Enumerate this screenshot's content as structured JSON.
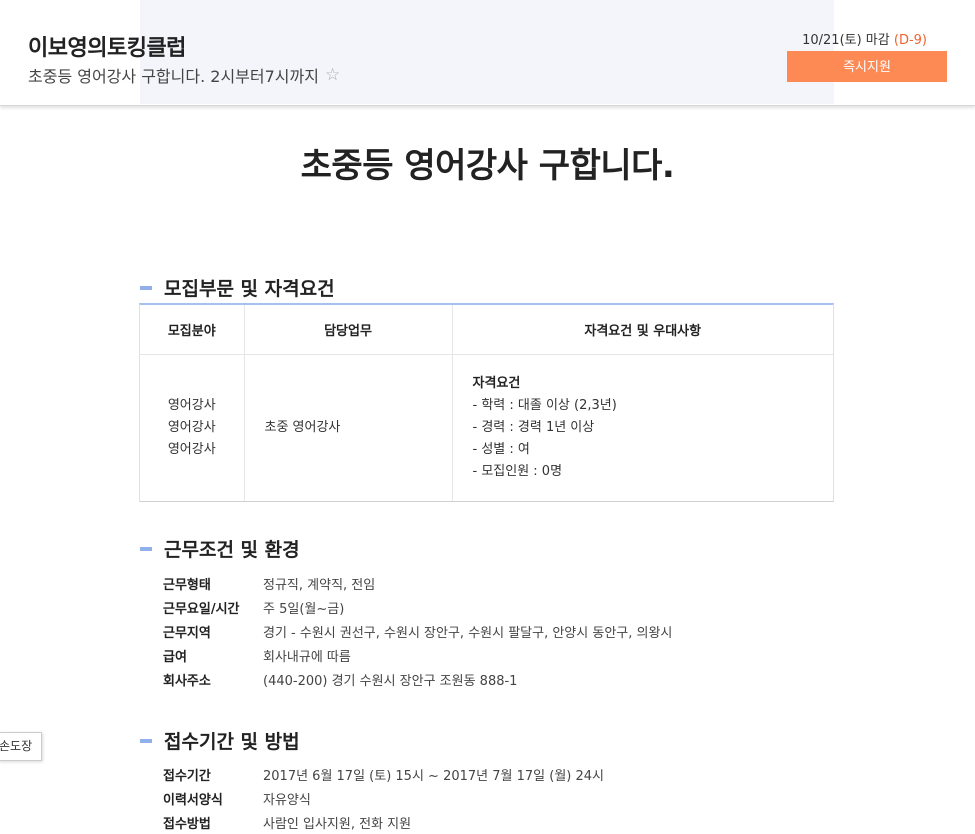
{
  "header": {
    "company": "이보영의토킹클럽",
    "subtitle": "초중등 영어강사 구합니다. 2시부터7시까지",
    "star_icon": "☆",
    "deadline_prefix": "10/21(토) 마감 ",
    "dday": "(D-9)",
    "apply_label": "즉시지원"
  },
  "main": {
    "title": "초중등 영어강사 구합니다."
  },
  "recruit": {
    "heading": "모집부문 및 자격요건",
    "columns": [
      "모집분야",
      "담당업무",
      "자격요건 및 우대사항"
    ],
    "fields": [
      "영어강사",
      "영어강사",
      "영어강사"
    ],
    "duty": "초중 영어강사",
    "qual_title": "자격요건",
    "qualifications": [
      "- 학력 : 대졸 이상 (2,3년)",
      "- 경력 : 경력 1년 이상",
      "- 성별 : 여",
      "- 모집인원 : 0명"
    ]
  },
  "conditions": {
    "heading": "근무조건 및 환경",
    "rows": [
      {
        "key": "근무형태",
        "value": "정규직, 계약직, 전임"
      },
      {
        "key": "근무요일/시간",
        "value": "주 5일(월~금)"
      },
      {
        "key": "근무지역",
        "value": "경기 - 수원시 권선구, 수원시 장안구, 수원시 팔달구, 안양시 동안구, 의왕시"
      },
      {
        "key": "급여",
        "value": "회사내규에 따름"
      },
      {
        "key": "회사주소",
        "value": "(440-200) 경기 수원시 장안구 조원동 888-1"
      }
    ]
  },
  "apply": {
    "heading": "접수기간 및 방법",
    "rows": [
      {
        "key": "접수기간",
        "value": "2017년 6월 17일 (토) 15시 ~ 2017년 7월 17일 (월) 24시"
      },
      {
        "key": "이력서양식",
        "value": "자유양식"
      },
      {
        "key": "접수방법",
        "value": "사람인 입사지원, 전화 지원"
      }
    ]
  },
  "side_tab": {
    "label": "손도장"
  }
}
